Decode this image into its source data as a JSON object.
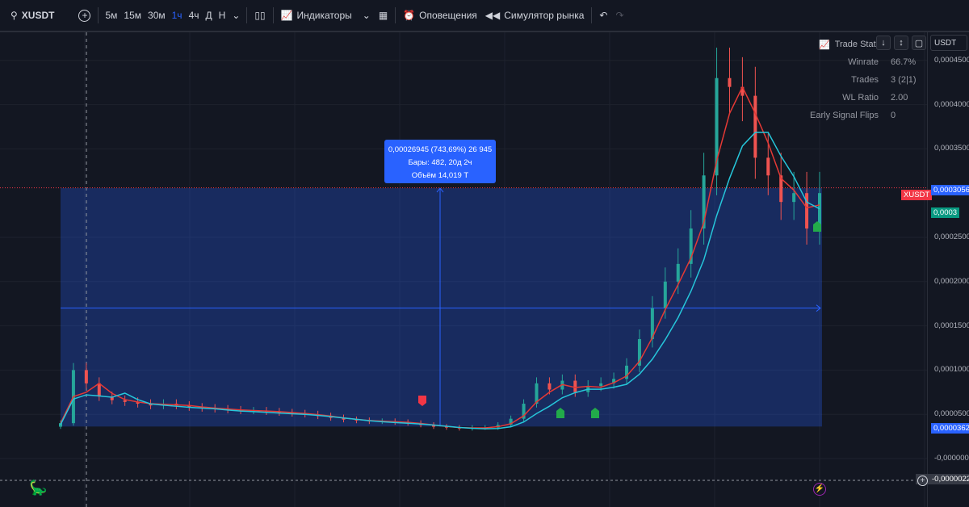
{
  "toolbar": {
    "symbol": "XUSDT",
    "timeframes": [
      "5м",
      "15м",
      "30м",
      "1ч",
      "4ч",
      "Д",
      "Н"
    ],
    "active_timeframe": "1ч",
    "indicators": "Индикаторы",
    "alerts": "Оповещения",
    "replay": "Симулятор рынка"
  },
  "trade_stats": {
    "title": "Trade Stats",
    "rows": [
      {
        "k": "Winrate",
        "v": "66.7%"
      },
      {
        "k": "Trades",
        "v": "3 (2|1)"
      },
      {
        "k": "WL Ratio",
        "v": "2.00"
      },
      {
        "k": "Early Signal Flips",
        "v": "0"
      }
    ]
  },
  "currency": "USDT",
  "price_axis": {
    "ticks": [
      "0,0004500",
      "0,0004000",
      "0,0003500",
      "0,0002500",
      "0,0002000",
      "0,0001500",
      "0,0001000",
      "0,0000500",
      "-0,0000000"
    ],
    "symbol_label": "XUSDT",
    "measure_top": "0,0003056",
    "measure_bottom": "0,0000362",
    "indicator_value": "0,0003",
    "crosshair_value": "-0,0000022"
  },
  "measure_tooltip": {
    "line1": "0,00026945 (743,69%) 26 945",
    "line2": "Бары: 482, 20д 2ч",
    "line3": "Объём 14,019 T"
  },
  "colors": {
    "up": "#26a69a",
    "down": "#ef5350",
    "ma": "#e53935",
    "ma2": "#26c6da",
    "measure": "#2962ff"
  },
  "chart_data": {
    "type": "candlestick",
    "tick_values": [
      0.00045,
      0.0004,
      0.00035,
      0.00025,
      0.0002,
      0.00015,
      0.0001,
      5e-05,
      0
    ],
    "closes": [
      4e-05,
      0.0001,
      8.5e-05,
      7e-05,
      6.6e-05,
      6.4e-05,
      6.2e-05,
      6e-05,
      6.2e-05,
      6e-05,
      5.8e-05,
      5.7e-05,
      5.6e-05,
      5.5e-05,
      5.4e-05,
      5.4e-05,
      5.3e-05,
      5.2e-05,
      5.1e-05,
      5e-05,
      4.8e-05,
      4.6e-05,
      4.4e-05,
      4.3e-05,
      4.2e-05,
      4.2e-05,
      4.1e-05,
      4e-05,
      3.8e-05,
      3.6e-05,
      3.5e-05,
      3.4e-05,
      3.5e-05,
      3.5e-05,
      3.8e-05,
      4.5e-05,
      6.2e-05,
      8.5e-05,
      7.8e-05,
      8.8e-05,
      7.5e-05,
      8.2e-05,
      8.5e-05,
      9e-05,
      0.000105,
      0.000135,
      0.00017,
      0.0002,
      0.00022,
      0.00026,
      0.00032,
      0.00043,
      0.00042,
      0.00041,
      0.00034,
      0.00032,
      0.00029,
      0.0003,
      0.00026,
      0.0003
    ],
    "measure_range": [
      3.62e-05,
      0.0003056
    ],
    "mid_line": 0.00017
  }
}
